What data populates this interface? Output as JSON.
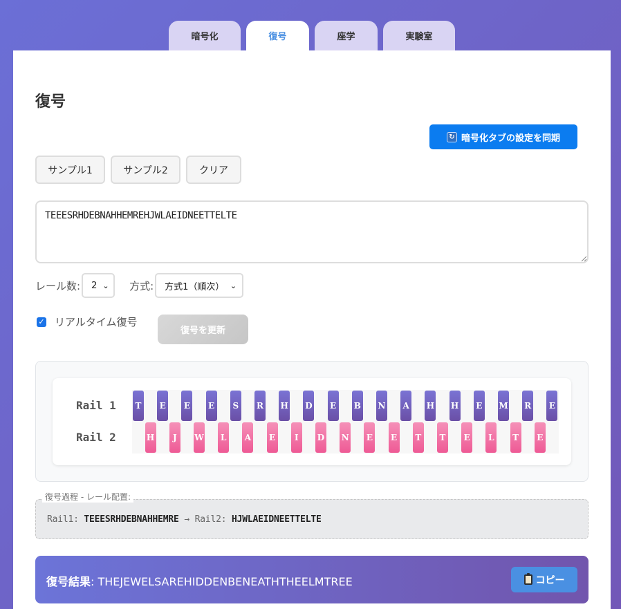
{
  "tabs": [
    {
      "label": "暗号化",
      "active": false
    },
    {
      "label": "復号",
      "active": true
    },
    {
      "label": "座学",
      "active": false
    },
    {
      "label": "実験室",
      "active": false
    }
  ],
  "page": {
    "title": "復号"
  },
  "sync_button": {
    "label": "暗号化タブの設定を同期",
    "icon": "refresh-icon"
  },
  "samples": {
    "sample1": "サンプル1",
    "sample2": "サンプル2",
    "clear": "クリア"
  },
  "cipher_input": {
    "value": "TEEESRHDEBNAHHEMREHJWLAEIDNEETTELTE"
  },
  "options": {
    "rails_label": "レール数:",
    "rails_value": "2",
    "method_label": "方式:",
    "method_value": "方式1（順次）"
  },
  "realtime": {
    "label": "リアルタイム復号",
    "checked": true
  },
  "update_button": {
    "label": "復号を更新"
  },
  "rails": {
    "rail1_label": "Rail 1",
    "rail2_label": "Rail 2",
    "rail1": [
      "T",
      "E",
      "E",
      "E",
      "S",
      "R",
      "H",
      "D",
      "E",
      "B",
      "N",
      "A",
      "H",
      "H",
      "E",
      "M",
      "R",
      "E"
    ],
    "rail2": [
      "H",
      "J",
      "W",
      "L",
      "A",
      "E",
      "I",
      "D",
      "N",
      "E",
      "E",
      "T",
      "T",
      "E",
      "L",
      "T",
      "E"
    ]
  },
  "process": {
    "legend": "復号過程 - レール配置:",
    "rail1_prefix": "Rail1:",
    "rail1_text": "TEEESRHDEBNAHHEMRE",
    "arrow": "→",
    "rail2_prefix": "Rail2:",
    "rail2_text": "HJWLAEIDNEETTELTE"
  },
  "result": {
    "label": "復号結果",
    "separator": ":",
    "value": "THEJEWELSAREHIDDENBENEATHTHEELMTREE",
    "copy_label": "コピー",
    "copy_icon": "clipboard-icon"
  },
  "colors": {
    "accent": "#0b7cf0",
    "tab_active_text": "#4a90e2",
    "rail1": "#6a4fa6",
    "rail2": "#ee5a95"
  }
}
